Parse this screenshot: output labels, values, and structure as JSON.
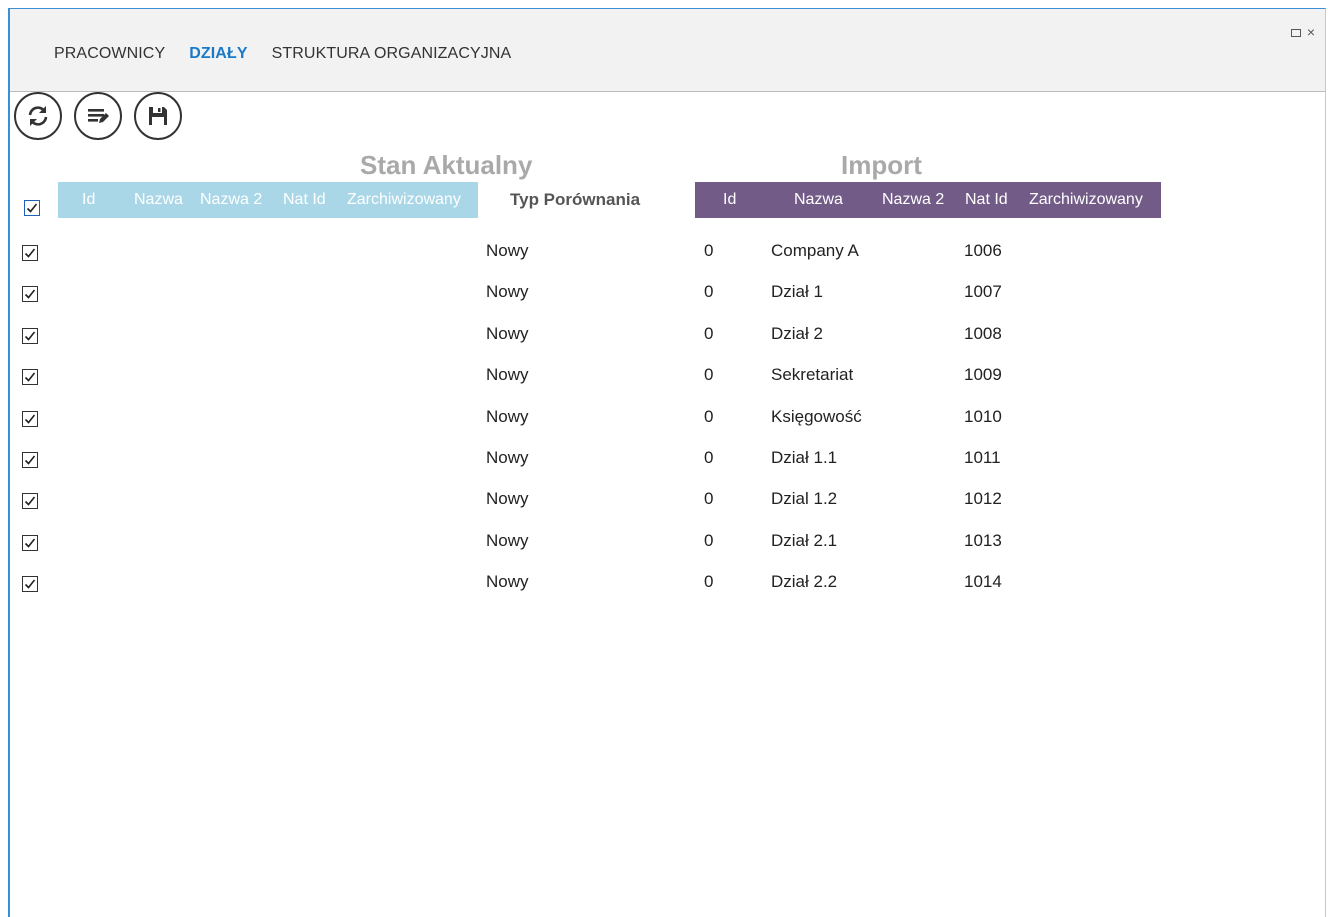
{
  "tabs": [
    {
      "label": "PRACOWNICY",
      "active": false
    },
    {
      "label": "DZIAŁY",
      "active": true
    },
    {
      "label": "STRUKTURA ORGANIZACYJNA",
      "active": false
    }
  ],
  "window": {
    "maximize_icon": "maximize-icon",
    "close_icon": "close-icon",
    "close_glyph": "×"
  },
  "toolbar": {
    "icons": [
      "refresh-icon",
      "edit-list-icon",
      "save-icon"
    ]
  },
  "sections": {
    "current": "Stan Aktualny",
    "import": "Import"
  },
  "current_columns": [
    "Id",
    "Nazwa",
    "Nazwa 2",
    "Nat Id",
    "Zarchiwizowany"
  ],
  "compare_header": "Typ Porównania",
  "import_columns": [
    "Id",
    "Nazwa",
    "Nazwa 2",
    "Nat Id",
    "Zarchiwizowany"
  ],
  "colors": {
    "accent": "#1b7ac8",
    "current_header": "#a9d7e8",
    "import_header": "#735b88",
    "title_gray": "#a9a9a9"
  },
  "rows": [
    {
      "checked": true,
      "type": "Nowy",
      "id": "0",
      "name": "Company A",
      "name2": "",
      "nat_id": "1006",
      "archived": ""
    },
    {
      "checked": true,
      "type": "Nowy",
      "id": "0",
      "name": "Dział 1",
      "name2": "",
      "nat_id": "1007",
      "archived": ""
    },
    {
      "checked": true,
      "type": "Nowy",
      "id": "0",
      "name": "Dział 2",
      "name2": "",
      "nat_id": "1008",
      "archived": ""
    },
    {
      "checked": true,
      "type": "Nowy",
      "id": "0",
      "name": "Sekretariat",
      "name2": "",
      "nat_id": "1009",
      "archived": ""
    },
    {
      "checked": true,
      "type": "Nowy",
      "id": "0",
      "name": "Księgowość",
      "name2": "",
      "nat_id": "1010",
      "archived": ""
    },
    {
      "checked": true,
      "type": "Nowy",
      "id": "0",
      "name": "Dział 1.1",
      "name2": "",
      "nat_id": "1011",
      "archived": ""
    },
    {
      "checked": true,
      "type": "Nowy",
      "id": "0",
      "name": "Dzial 1.2",
      "name2": "",
      "nat_id": "1012",
      "archived": ""
    },
    {
      "checked": true,
      "type": "Nowy",
      "id": "0",
      "name": "Dział 2.1",
      "name2": "",
      "nat_id": "1013",
      "archived": ""
    },
    {
      "checked": true,
      "type": "Nowy",
      "id": "0",
      "name": "Dział 2.2",
      "name2": "",
      "nat_id": "1014",
      "archived": ""
    }
  ]
}
